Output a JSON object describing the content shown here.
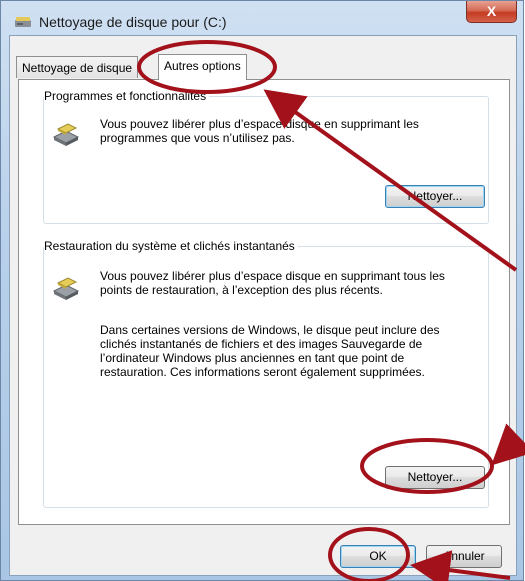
{
  "window": {
    "title": "Nettoyage de disque pour  (C:)",
    "close_symbol": "X"
  },
  "tabs": [
    {
      "label": "Nettoyage de disque",
      "active": false
    },
    {
      "label": "Autres options",
      "active": true
    }
  ],
  "programs_group": {
    "title": "Programmes et fonctionnalités",
    "description_line1": "Vous pouvez libérer plus d’espace disque en supprimant les",
    "description_line2": "programmes que vous n’utilisez pas.",
    "button": "Nettoyer..."
  },
  "restore_group": {
    "title": "Restauration du système et clichés instantanés",
    "description1_line1": "Vous pouvez libérer plus d’espace disque en supprimant tous les",
    "description1_line2": "points de restauration, à l’exception des plus récents.",
    "description2_line1": "Dans certaines versions de Windows, le disque peut inclure des",
    "description2_line2": "clichés instantanés de fichiers et des images Sauvegarde de",
    "description2_line3": "l’ordinateur Windows plus anciennes en tant que point de",
    "description2_line4": "restauration. Ces informations seront également supprimées.",
    "button": "Nettoyer..."
  },
  "footer": {
    "ok": "OK",
    "cancel": "Annuler"
  },
  "colors": {
    "annotation": "#a3111b",
    "window_frame": "#b9d1ea",
    "close_button": "#c43b22"
  },
  "icons": [
    "disk-cleanup-icon",
    "close-icon",
    "drive-icon"
  ]
}
